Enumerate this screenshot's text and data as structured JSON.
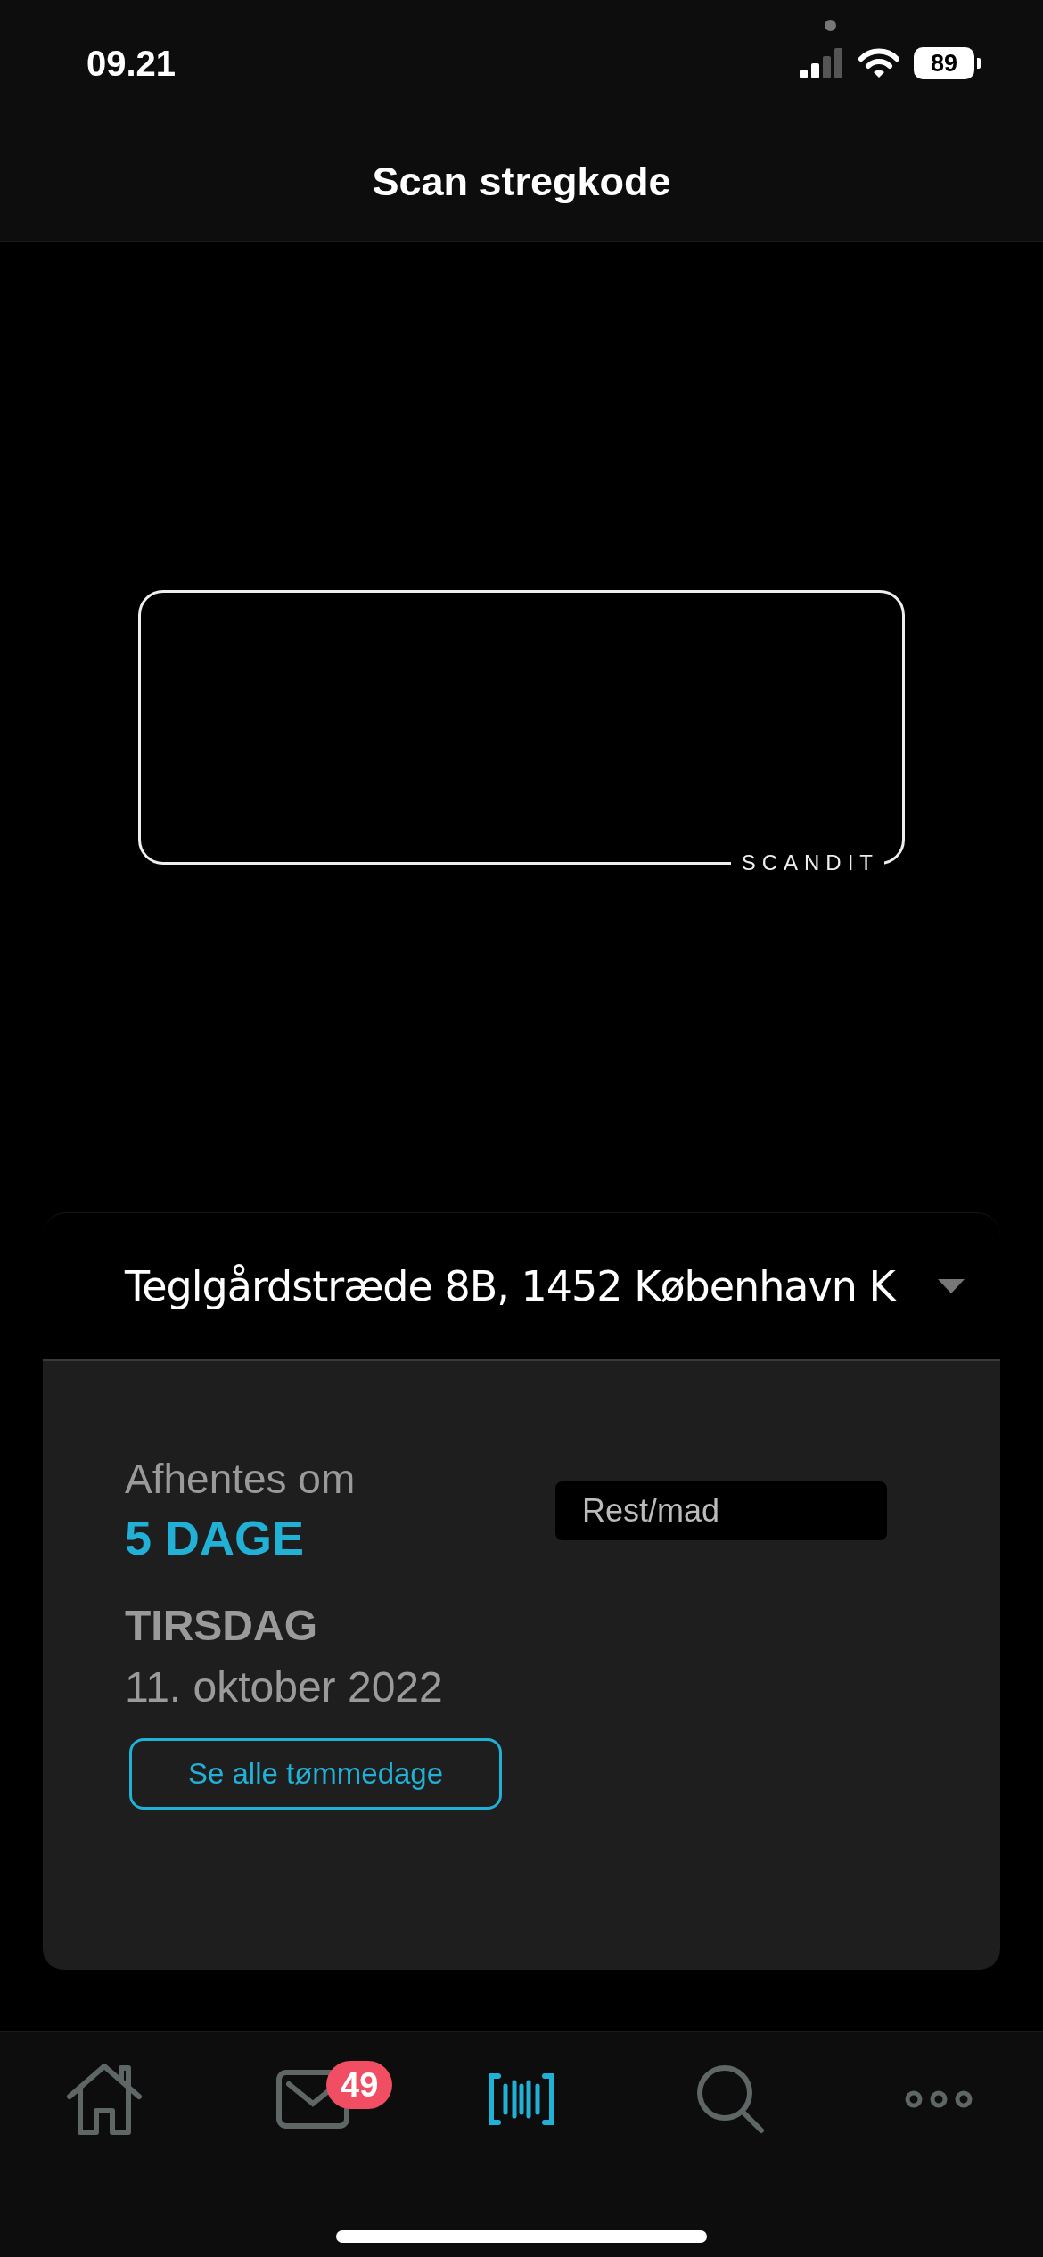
{
  "status_bar": {
    "time": "09.21",
    "battery": "89"
  },
  "header": {
    "title": "Scan stregkode"
  },
  "scanner": {
    "logo": "SCANDIT"
  },
  "address": {
    "text": "Teglgårdstræde 8B, 1452 København K"
  },
  "pickup": {
    "label": "Afhentes om",
    "countdown": "5 DAGE",
    "weekday": "TIRSDAG",
    "date": "11. oktober 2022",
    "category": "Rest/mad",
    "button": "Se alle tømmedage"
  },
  "tabs": [
    {
      "kind": "home",
      "selected": false
    },
    {
      "kind": "mail",
      "selected": false,
      "badge": "49"
    },
    {
      "kind": "scan",
      "selected": true
    },
    {
      "kind": "search",
      "selected": false
    },
    {
      "kind": "more",
      "selected": false
    }
  ]
}
